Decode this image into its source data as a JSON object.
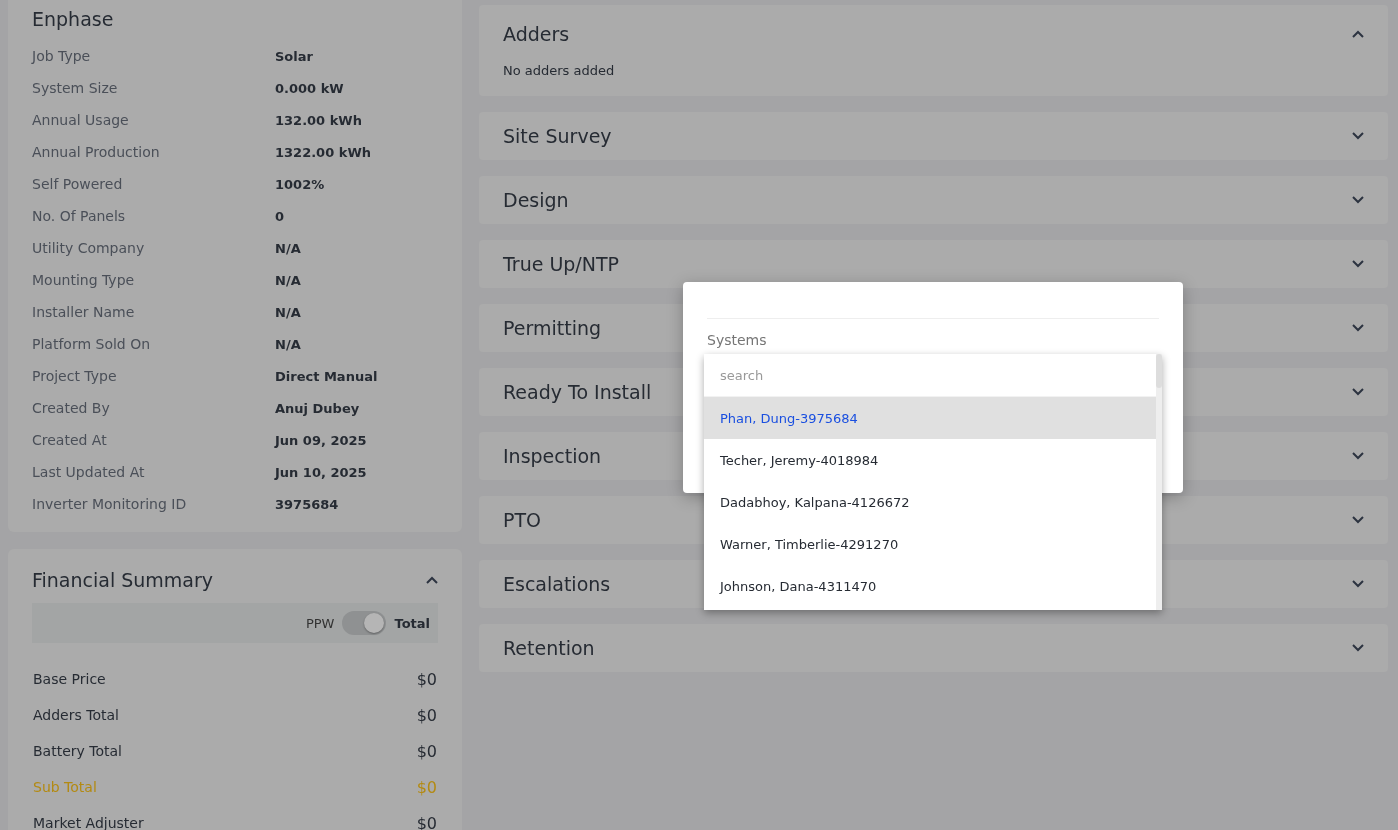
{
  "details": {
    "title": "Enphase",
    "rows": [
      {
        "label": "Job Type",
        "value": "Solar"
      },
      {
        "label": "System Size",
        "value": "0.000 kW"
      },
      {
        "label": "Annual Usage",
        "value": "132.00 kWh"
      },
      {
        "label": "Annual Production",
        "value": "1322.00 kWh"
      },
      {
        "label": "Self Powered",
        "value": "1002%"
      },
      {
        "label": "No. Of Panels",
        "value": "0"
      },
      {
        "label": "Utility Company",
        "value": "N/A"
      },
      {
        "label": "Mounting Type",
        "value": "N/A"
      },
      {
        "label": "Installer Name",
        "value": "N/A"
      },
      {
        "label": "Platform Sold On",
        "value": "N/A"
      },
      {
        "label": "Project Type",
        "value": "Direct Manual"
      },
      {
        "label": "Created By",
        "value": "Anuj Dubey"
      },
      {
        "label": "Created At",
        "value": "Jun 09, 2025"
      },
      {
        "label": "Last Updated At",
        "value": "Jun 10, 2025"
      },
      {
        "label": "Inverter Monitoring ID",
        "value": "3975684"
      }
    ]
  },
  "financial_summary": {
    "title": "Financial Summary",
    "expanded": true,
    "toggle": {
      "left_label": "PPW",
      "right_label": "Total",
      "on": true
    },
    "rows": [
      {
        "label": "Base Price",
        "value": "$0",
        "kind": "normal"
      },
      {
        "label": "Adders Total",
        "value": "$0",
        "kind": "normal"
      },
      {
        "label": "Battery Total",
        "value": "$0",
        "kind": "normal"
      },
      {
        "label": "Sub Total",
        "value": "$0",
        "kind": "highlight"
      },
      {
        "label": "Market Adjuster",
        "value": "$0",
        "kind": "normal"
      }
    ]
  },
  "sections": [
    {
      "title": "Adders",
      "expanded": true,
      "body": "No adders added"
    },
    {
      "title": "Site Survey",
      "expanded": false
    },
    {
      "title": "Design",
      "expanded": false
    },
    {
      "title": "True Up/NTP",
      "expanded": false
    },
    {
      "title": "Permitting",
      "expanded": false
    },
    {
      "title": "Ready To Install",
      "expanded": false
    },
    {
      "title": "Inspection",
      "expanded": false
    },
    {
      "title": "PTO",
      "expanded": false
    },
    {
      "title": "Escalations",
      "expanded": false
    },
    {
      "title": "Retention",
      "expanded": false
    }
  ],
  "modal": {
    "field_label": "Systems",
    "search": {
      "placeholder": "search"
    },
    "options": [
      {
        "label": "Phan, Dung-3975684",
        "selected": true
      },
      {
        "label": "Techer, Jeremy-4018984",
        "selected": false
      },
      {
        "label": "Dadabhoy, Kalpana-4126672",
        "selected": false
      },
      {
        "label": "Warner, Timberlie-4291270",
        "selected": false
      },
      {
        "label": "Johnson, Dana-4311470",
        "selected": false
      }
    ]
  }
}
